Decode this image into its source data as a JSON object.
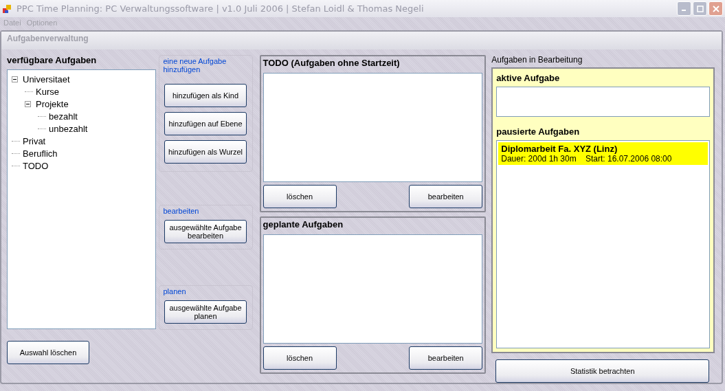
{
  "window": {
    "title": "PPC Time Planning: PC Verwaltungssoftware | v1.0 Juli 2006 | Stefan Loidl & Thomas Negeli"
  },
  "menu": [
    "Datei",
    "Optionen"
  ],
  "panel_title": "Aufgabenverwaltung",
  "tree": {
    "title": "verfügbare Aufgaben",
    "items": [
      {
        "label": "Universitaet",
        "expanded": true,
        "children": [
          {
            "label": "Kurse"
          },
          {
            "label": "Projekte",
            "expanded": true,
            "children": [
              {
                "label": "bezahlt"
              },
              {
                "label": "unbezahlt"
              }
            ]
          }
        ]
      },
      {
        "label": "Privat"
      },
      {
        "label": "Beruflich"
      },
      {
        "label": "TODO"
      }
    ],
    "button": "Auswahl löschen"
  },
  "groups": [
    {
      "title": "eine neue Aufgabe hinzufügen",
      "buttons": [
        "hinzufügen als Kind",
        "hinzufügen auf Ebene",
        "hinzufügen als Wurzel"
      ]
    },
    {
      "title": "bearbeiten",
      "buttons": [
        "ausgewählte Aufgabe bearbeiten"
      ]
    },
    {
      "title": "planen",
      "buttons": [
        "ausgewählte Aufgabe planen"
      ]
    }
  ],
  "lists": [
    {
      "title": "TODO (Aufgaben ohne Startzeit)",
      "buttons": [
        "löschen",
        "bearbeiten"
      ]
    },
    {
      "title": "geplante Aufgaben",
      "buttons": [
        "löschen",
        "bearbeiten"
      ]
    }
  ],
  "in_progress": {
    "title": "Aufgaben in Bearbeitung",
    "active_title": "aktive Aufgabe",
    "paused_title": "pausierte Aufgaben",
    "paused": [
      {
        "name": "Diplomarbeit Fa. XYZ (Linz)",
        "details": "Dauer: 200d 1h 30m    Start: 16.07.2006 08:00",
        "selected": true
      }
    ],
    "button": "Statistik betrachten"
  }
}
